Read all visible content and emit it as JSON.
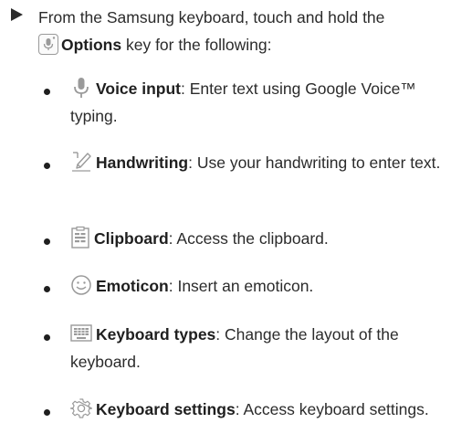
{
  "step": {
    "prefix": "From the Samsung keyboard, touch and hold the",
    "key_name": "Options",
    "suffix": " key for the following:"
  },
  "bullets": [
    {
      "icon": "microphone-icon",
      "label": "Voice input",
      "desc": ": Enter text using Google Voice™ typing."
    },
    {
      "icon": "handwriting-pen-icon",
      "label": "Handwriting",
      "desc": ": Use your handwriting to enter text."
    },
    {
      "icon": "clipboard-icon",
      "label": "Clipboard",
      "desc": ": Access the clipboard."
    },
    {
      "icon": "emoticon-smiley-icon",
      "label": "Emoticon",
      "desc": ": Insert an emoticon."
    },
    {
      "icon": "keyboard-icon",
      "label": "Keyboard types",
      "desc": ": Change the layout of the keyboard."
    },
    {
      "icon": "gear-icon",
      "label": "Keyboard settings",
      "desc": ": Access keyboard settings."
    }
  ],
  "colors": {
    "text": "#2b2b2b",
    "icon": "#9a9a9a"
  }
}
